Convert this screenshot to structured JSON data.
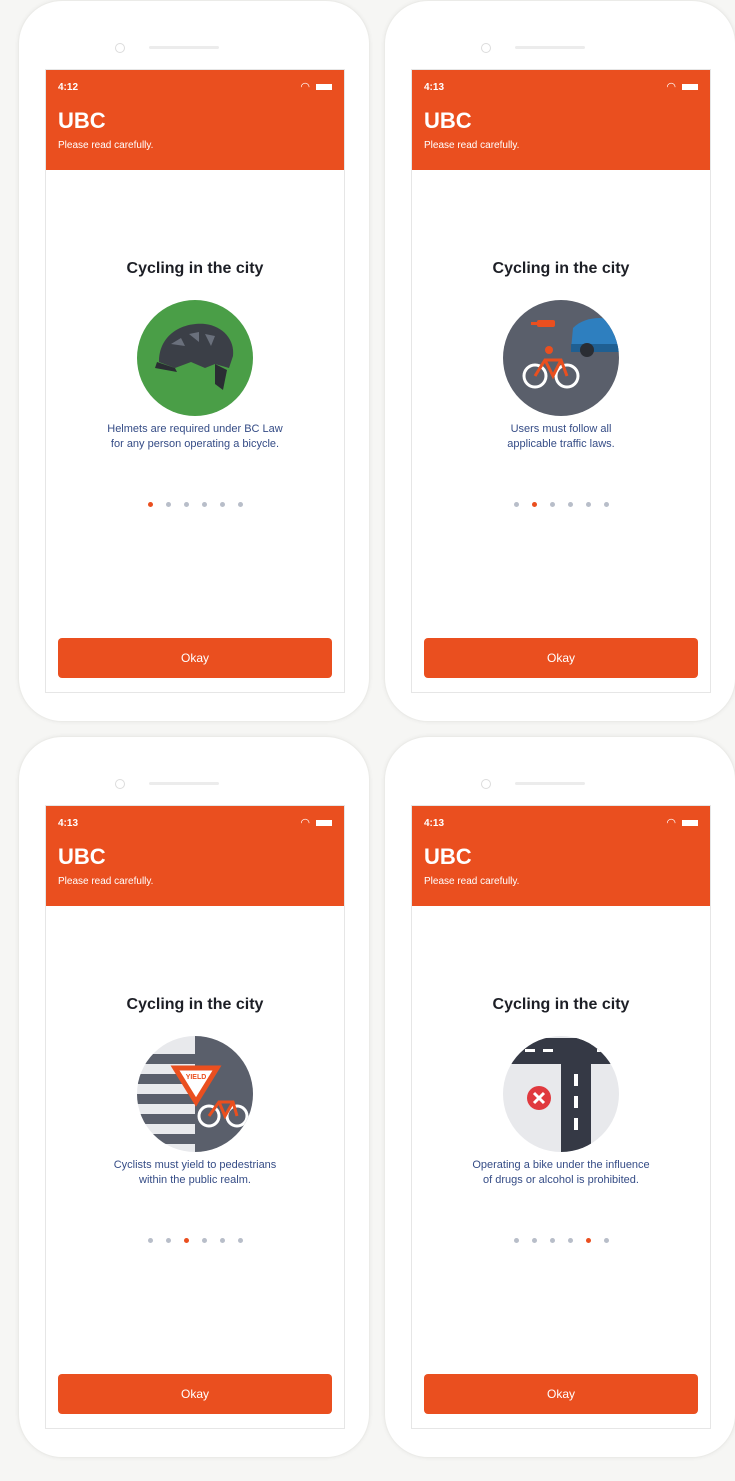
{
  "screens": [
    {
      "time": "4:12",
      "app_title": "UBC",
      "subtitle": "Please read carefully.",
      "heading": "Cycling in the city",
      "illustration": "helmet-icon",
      "caption_line1": "Helmets are required under BC Law",
      "caption_line2": "for any person operating a bicycle.",
      "active_dot": 0,
      "button_label": "Okay"
    },
    {
      "time": "4:13",
      "app_title": "UBC",
      "subtitle": "Please read carefully.",
      "heading": "Cycling in the city",
      "illustration": "traffic-bike-icon",
      "caption_line1": "Users must follow all",
      "caption_line2": "applicable traffic laws.",
      "active_dot": 1,
      "button_label": "Okay"
    },
    {
      "time": "4:13",
      "app_title": "UBC",
      "subtitle": "Please read carefully.",
      "heading": "Cycling in the city",
      "illustration": "yield-crosswalk-icon",
      "yield_text": "YIELD",
      "caption_line1": "Cyclists must yield to pedestrians",
      "caption_line2": "within the public realm.",
      "active_dot": 2,
      "button_label": "Okay"
    },
    {
      "time": "4:13",
      "app_title": "UBC",
      "subtitle": "Please read carefully.",
      "heading": "Cycling in the city",
      "illustration": "no-impaired-road-icon",
      "caption_line1": "Operating a bike under the influence",
      "caption_line2": "of drugs or alcohol is prohibited.",
      "active_dot": 4,
      "button_label": "Okay"
    }
  ],
  "dot_count": 6,
  "colors": {
    "accent": "#ea4f1f",
    "text_dark": "#1d1f26",
    "caption_blue": "#354c86",
    "dot_inactive": "#b8bec9",
    "helmet_green": "#4a9e47",
    "road_gray": "#5a5f6b"
  }
}
